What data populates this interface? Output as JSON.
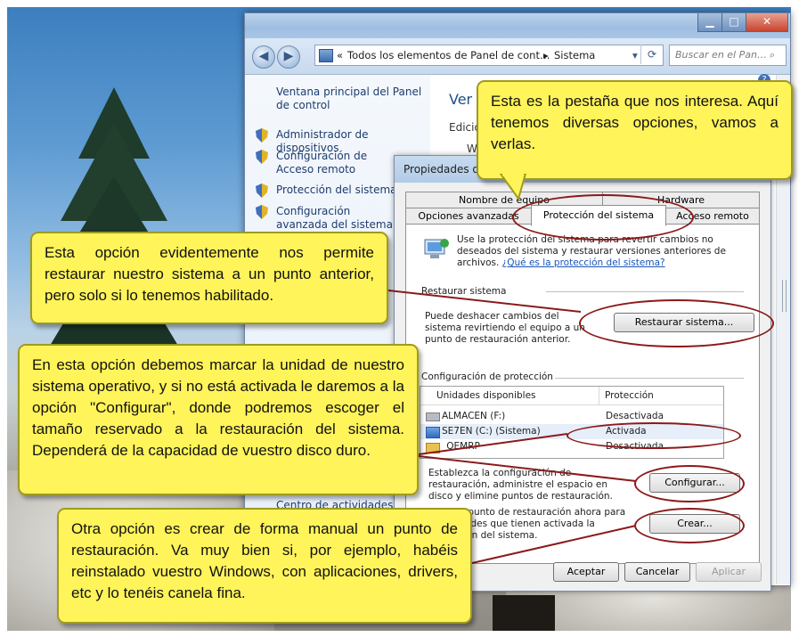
{
  "window": {
    "minimize_glyph": "▁",
    "maximize_glyph": "□",
    "close_glyph": "✕"
  },
  "nav": {
    "back_glyph": "◀",
    "forward_glyph": "▶",
    "address_prefix": "«",
    "address_path": "Todos los elementos de Panel de cont…",
    "address_sep": "▸",
    "address_current": "Sistema",
    "search_placeholder": "Buscar en el Pan…"
  },
  "left_pane": {
    "main_link": "Ventana principal del Panel de control",
    "links": [
      "Administrador de dispositivos",
      "Configuración de Acceso remoto",
      "Protección del sistema",
      "Configuración avanzada del sistema"
    ],
    "bottom_link": "Centro de actividades"
  },
  "main": {
    "heading": "Ver i",
    "line1": "Edició",
    "line2": "W"
  },
  "dialog": {
    "title": "Propiedades de",
    "tabs_row1": [
      "Nombre de equipo",
      "Hardware"
    ],
    "tabs_row2": [
      "Opciones avanzadas",
      "Protección del sistema",
      "Acceso remoto"
    ],
    "intro_text": "Use la protección del sistema para revertir cambios no deseados del sistema y restaurar versiones anteriores de archivos.",
    "intro_link": "¿Qué es la protección del sistema?",
    "restore_section": "Restaurar sistema",
    "restore_desc": "Puede deshacer cambios del sistema revirtiendo el equipo a un punto de restauración anterior.",
    "restore_button": "Restaurar sistema...",
    "protection_section": "Configuración de protección",
    "columns": [
      "Unidades disponibles",
      "Protección"
    ],
    "drives": [
      {
        "name": "ALMACEN (F:)",
        "status": "Desactivada"
      },
      {
        "name": "SE7EN (C:) (Sistema)",
        "status": "Activada"
      },
      {
        "name": "_OEMRP",
        "status": "Desactivada"
      }
    ],
    "config_desc": "Establezca la configuración de restauración, administre el espacio en disco y elimine puntos de restauración.",
    "config_button": "Configurar...",
    "create_desc": "Cree un punto de restauración ahora para las unidades que tienen activada la protección del sistema.",
    "create_button": "Crear...",
    "ok_button": "Aceptar",
    "cancel_button": "Cancelar",
    "apply_button": "Aplicar"
  },
  "callouts": {
    "tab_note": "Esta es la pestaña que nos interesa. Aquí tenemos diversas opciones, vamos a verlas.",
    "restore_note": "Esta opción evidentemente nos permite restaurar nuestro sistema a un punto anterior, pero solo si lo tenemos habilitado.",
    "config_note": "En esta opción debemos marcar la unidad de nuestro sistema operativo, y si no está activada le daremos a la opción \"Configurar\", donde podremos escoger el tamaño reservado a la restauración del sistema. Dependerá de la capacidad de vuestro disco duro.",
    "create_note": "Otra opción es crear de forma manual un punto de restauración. Va muy bien si, por ejemplo, habéis reinstalado vuestro Windows, con aplicaciones, drivers, etc y lo tenéis canela fina."
  },
  "colors": {
    "callout_fill": "#fff45a",
    "annotation": "#8b1a1a",
    "link": "#1d3c6e"
  }
}
